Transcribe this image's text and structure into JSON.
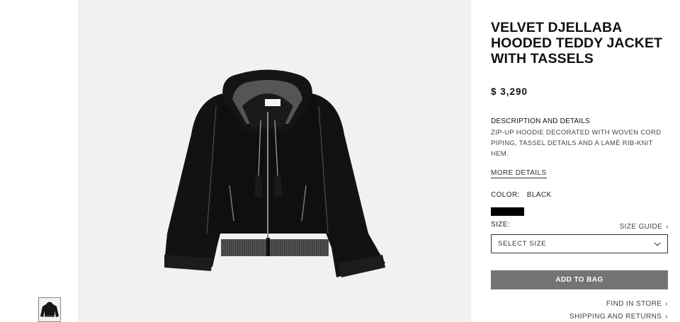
{
  "product": {
    "title": "VELVET DJELLABA HOODED TEDDY JACKET WITH TASSELS",
    "price": "$  3,290",
    "description_heading": "DESCRIPTION AND DETAILS",
    "description_body": "ZIP-UP HOODIE DECORATED WITH WOVEN CORD PIPING, TASSEL DETAILS AND A LAMÉ RIB-KNIT HEM.",
    "more_details_label": "MORE DETAILS"
  },
  "color": {
    "label": "COLOR:",
    "value": "BLACK",
    "swatch_hex": "#000000"
  },
  "size": {
    "label": "SIZE:",
    "guide_label": "SIZE GUIDE",
    "select_placeholder": "SELECT SIZE"
  },
  "actions": {
    "add_to_bag": "ADD TO BAG",
    "find_in_store": "FIND IN STORE",
    "shipping_returns": "SHIPPING AND RETURNS"
  },
  "icons": {
    "chevron_right": "›",
    "chevron_down": "⌄"
  },
  "colors": {
    "hero_bg": "#f1f1f1",
    "button_bg": "#747474"
  }
}
